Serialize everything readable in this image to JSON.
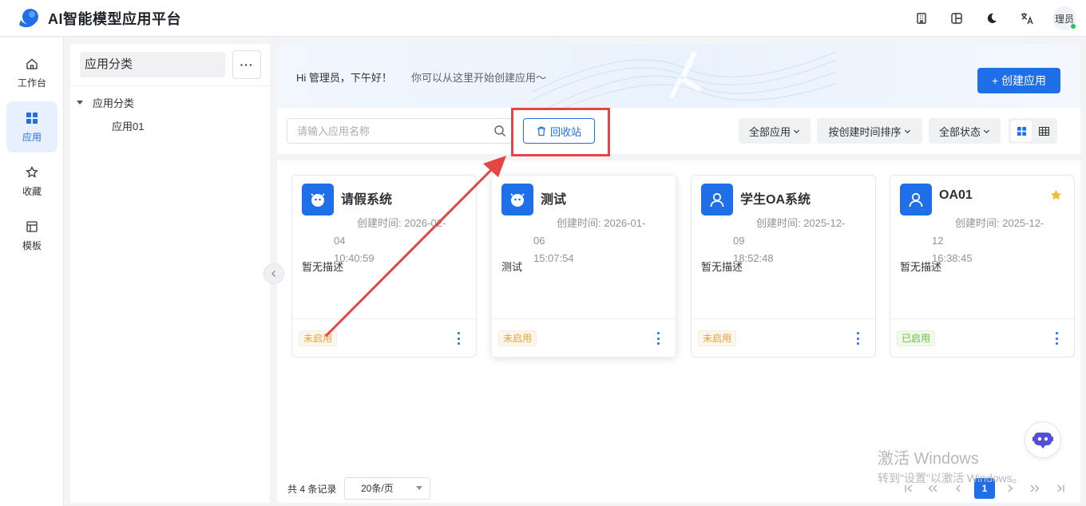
{
  "app": {
    "title": "AI智能模型应用平台"
  },
  "header": {
    "icons": [
      "building-icon",
      "layout-icon",
      "moon-icon",
      "translate-icon"
    ],
    "avatar_text": "理员",
    "online_color": "#22c55e"
  },
  "nav": {
    "items": [
      {
        "label": "工作台",
        "icon": "home-icon"
      },
      {
        "label": "应用",
        "icon": "grid-icon",
        "active": true
      },
      {
        "label": "收藏",
        "icon": "star-icon"
      },
      {
        "label": "模板",
        "icon": "template-icon"
      }
    ]
  },
  "category": {
    "title": "应用分类",
    "more": "···",
    "tree_root": "应用分类",
    "tree_children": [
      "应用01"
    ]
  },
  "banner": {
    "greeting": "Hi 管理员，下午好！",
    "subtitle": "你可以从这里开始创建应用～",
    "create_button": "+ 创建应用"
  },
  "toolbar": {
    "search_placeholder": "请输入应用名称",
    "recycle_button": "回收站",
    "filters": [
      "全部应用",
      "按创建时间排序",
      "全部状态"
    ],
    "view_modes": [
      "card",
      "table"
    ],
    "active_view": "card"
  },
  "cards": [
    {
      "title": "请假系统",
      "time_label": "创建时间: 2026-02-04",
      "time_clock": "10:40:59",
      "desc": "暂无描述",
      "status": "未启用",
      "icon": "robot-icon",
      "starred": false
    },
    {
      "title": "测试",
      "time_label": "创建时间: 2026-01-06",
      "time_clock": "15:07:54",
      "desc": "测试",
      "status": "未启用",
      "icon": "robot-icon",
      "starred": false
    },
    {
      "title": "学生OA系统",
      "time_label": "创建时间: 2025-12-09",
      "time_clock": "18:52:48",
      "desc": "暂无描述",
      "status": "未启用",
      "icon": "user-icon",
      "starred": false
    },
    {
      "title": "OA01",
      "time_label": "创建时间: 2025-12-12",
      "time_clock": "16:38:45",
      "desc": "暂无描述",
      "status": "已启用",
      "icon": "user-icon",
      "starred": true
    }
  ],
  "pagination": {
    "total": "共 4 条记录",
    "page_size": "20条/页",
    "current_page": "1"
  },
  "watermark": {
    "title": "激活 Windows",
    "subtitle": "转到\"设置\"以激活 Windows。"
  },
  "colors": {
    "primary": "#1e6fe8",
    "annotation": "#e64545",
    "badge_off": "#e6a23c",
    "badge_on": "#67c23a",
    "star": "#f7b731"
  }
}
